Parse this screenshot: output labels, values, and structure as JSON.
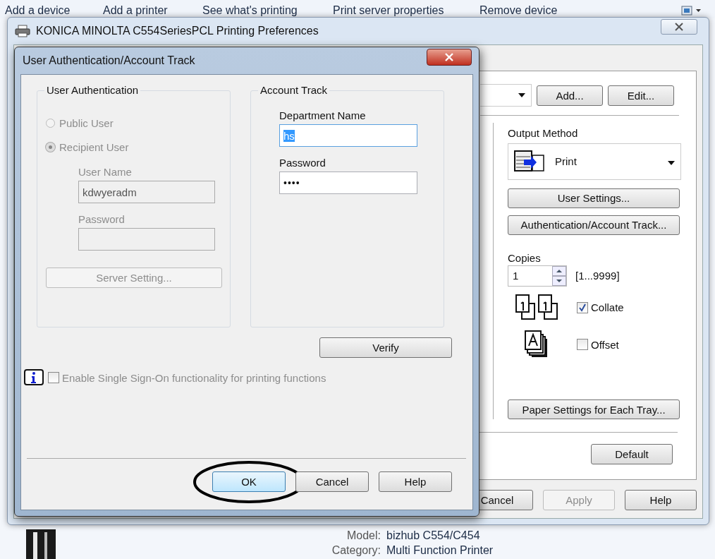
{
  "explorer_toolbar": [
    "Add a device",
    "Add a printer",
    "See what's printing",
    "Print server properties",
    "Remove device"
  ],
  "window": {
    "title": "KONICA MINOLTA C554SeriesPCL Printing Preferences"
  },
  "preferences": {
    "favorite_buttons": [
      "Add...",
      "Edit..."
    ],
    "output_method": {
      "label": "Output Method",
      "value": "Print"
    },
    "buttons": [
      "User Settings...",
      "Authentication/Account Track..."
    ],
    "copies": {
      "label": "Copies",
      "value": "1",
      "range": "[1...9999]"
    },
    "collate": {
      "label": "Collate",
      "checked": true
    },
    "offset": {
      "label": "Offset",
      "checked": false
    },
    "tray_button": "Paper Settings for Each Tray...",
    "default_button": "Default"
  },
  "footer_buttons": [
    {
      "label": "Cancel",
      "disabled": false
    },
    {
      "label": "Apply",
      "disabled": true
    },
    {
      "label": "Help",
      "disabled": false
    }
  ],
  "device_info": [
    {
      "label": "Model:",
      "value": "bizhub C554/C454"
    },
    {
      "label": "Category:",
      "value": "Multi Function Printer"
    }
  ],
  "dialog": {
    "title": "User Authentication/Account Track",
    "user_authentication": {
      "title": "User Authentication",
      "disabled": true,
      "options": [
        {
          "label": "Public User",
          "selected": false
        },
        {
          "label": "Recipient User",
          "selected": true
        }
      ],
      "user_name": {
        "label": "User Name",
        "value": "kdwyeradm"
      },
      "password": {
        "label": "Password"
      },
      "server_button": "Server Setting..."
    },
    "account_track": {
      "title": "Account Track",
      "department": {
        "label": "Department Name",
        "value": "hs"
      },
      "password": {
        "label": "Password",
        "value": "••••"
      }
    },
    "verify_button": "Verify",
    "sso": {
      "label": "Enable Single Sign-On functionality for printing functions",
      "checked": false,
      "disabled": true
    },
    "buttons": [
      {
        "label": "OK",
        "highlighted": true
      },
      {
        "label": "Cancel",
        "highlighted": false
      },
      {
        "label": "Help",
        "highlighted": false
      }
    ]
  }
}
